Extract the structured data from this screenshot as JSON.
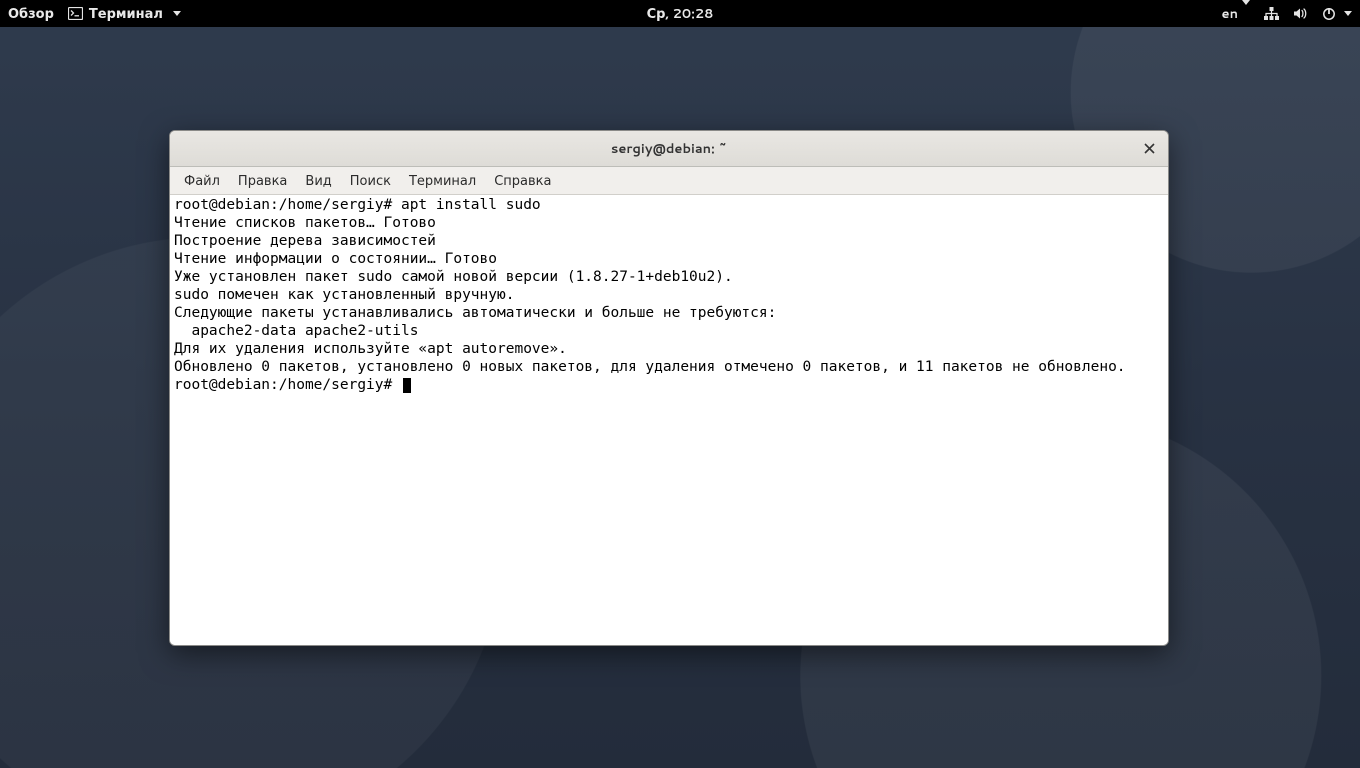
{
  "topbar": {
    "overview": "Обзор",
    "app_name": "Терминал",
    "clock": "Ср, 20:28",
    "lang": "en"
  },
  "window": {
    "title": "sergiy@debian: ~",
    "menu": {
      "file": "Файл",
      "edit": "Правка",
      "view": "Вид",
      "search": "Поиск",
      "terminal": "Терминал",
      "help": "Справка"
    }
  },
  "terminal": {
    "prompt": "root@debian:/home/sergiy# ",
    "lines": [
      "root@debian:/home/sergiy# apt install sudo",
      "Чтение списков пакетов… Готово",
      "Построение дерева зависимостей",
      "Чтение информации о состоянии… Готово",
      "Уже установлен пакет sudo самой новой версии (1.8.27-1+deb10u2).",
      "sudo помечен как установленный вручную.",
      "Следующие пакеты устанавливались автоматически и больше не требуются:",
      "  apache2-data apache2-utils",
      "Для их удаления используйте «apt autoremove».",
      "Обновлено 0 пакетов, установлено 0 новых пакетов, для удаления отмечено 0 пакетов, и 11 пакетов не обновлено."
    ]
  }
}
